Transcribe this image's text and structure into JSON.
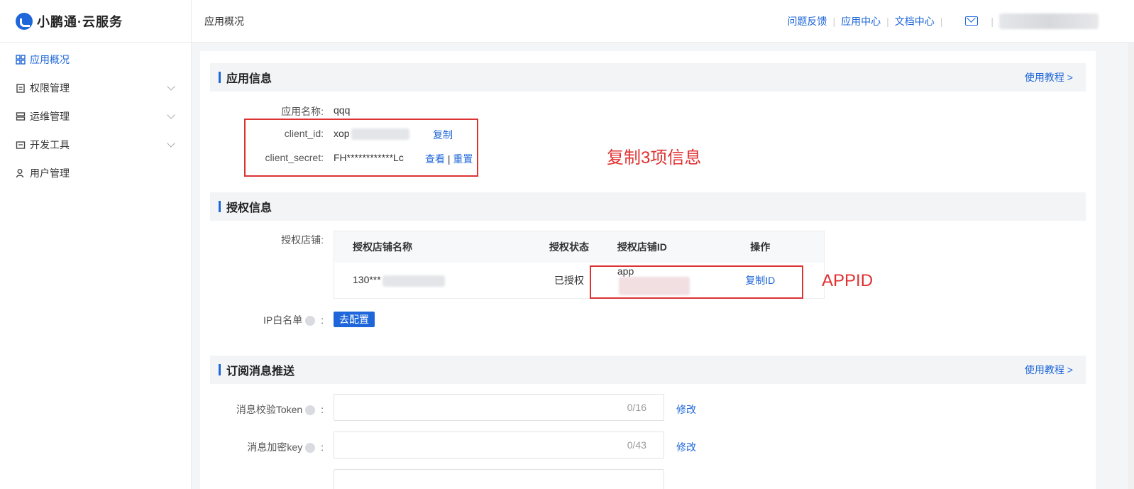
{
  "brand": {
    "name": "小鹏通·云服务"
  },
  "sidebar": {
    "items": [
      {
        "label": "应用概况",
        "icon": "grid-icon",
        "active": true
      },
      {
        "label": "权限管理",
        "icon": "clipboard-icon",
        "expandable": true
      },
      {
        "label": "运维管理",
        "icon": "server-icon",
        "expandable": true
      },
      {
        "label": "开发工具",
        "icon": "toolbox-icon",
        "expandable": true
      },
      {
        "label": "用户管理",
        "icon": "user-icon"
      }
    ]
  },
  "header": {
    "title": "应用概况",
    "links": [
      "问题反馈",
      "应用中心",
      "文档中心"
    ]
  },
  "app_info": {
    "section_title": "应用信息",
    "tutorial_link": "使用教程 >",
    "app_name_label": "应用名称:",
    "app_name_value": "qqq",
    "client_id_label": "client_id:",
    "client_id_value": "xop",
    "copy_label": "复制",
    "client_secret_label": "client_secret:",
    "client_secret_value": "FH************Lc",
    "view_label": "查看",
    "divider": "|",
    "reset_label": "重置"
  },
  "annotations": {
    "copy_three": "复制3项信息",
    "appid": "APPID"
  },
  "auth_info": {
    "section_title": "授权信息",
    "shops_label": "授权店铺:",
    "table": {
      "headers": [
        "授权店铺名称",
        "授权状态",
        "授权店铺ID",
        "操作"
      ],
      "rows": [
        {
          "name": "130***",
          "status": "已授权",
          "shop_id": "app",
          "action": "复制ID"
        }
      ]
    },
    "ip_whitelist_label": "IP白名单",
    "colon": ":",
    "configure_button": "去配置"
  },
  "subscription": {
    "section_title": "订阅消息推送",
    "tutorial_link": "使用教程 >",
    "token_label": "消息校验Token",
    "token_count": "0/16",
    "key_label": "消息加密key",
    "key_count": "0/43",
    "modify_label": "修改"
  },
  "colors": {
    "accent": "#1e66d9",
    "annotation": "#e03030"
  }
}
